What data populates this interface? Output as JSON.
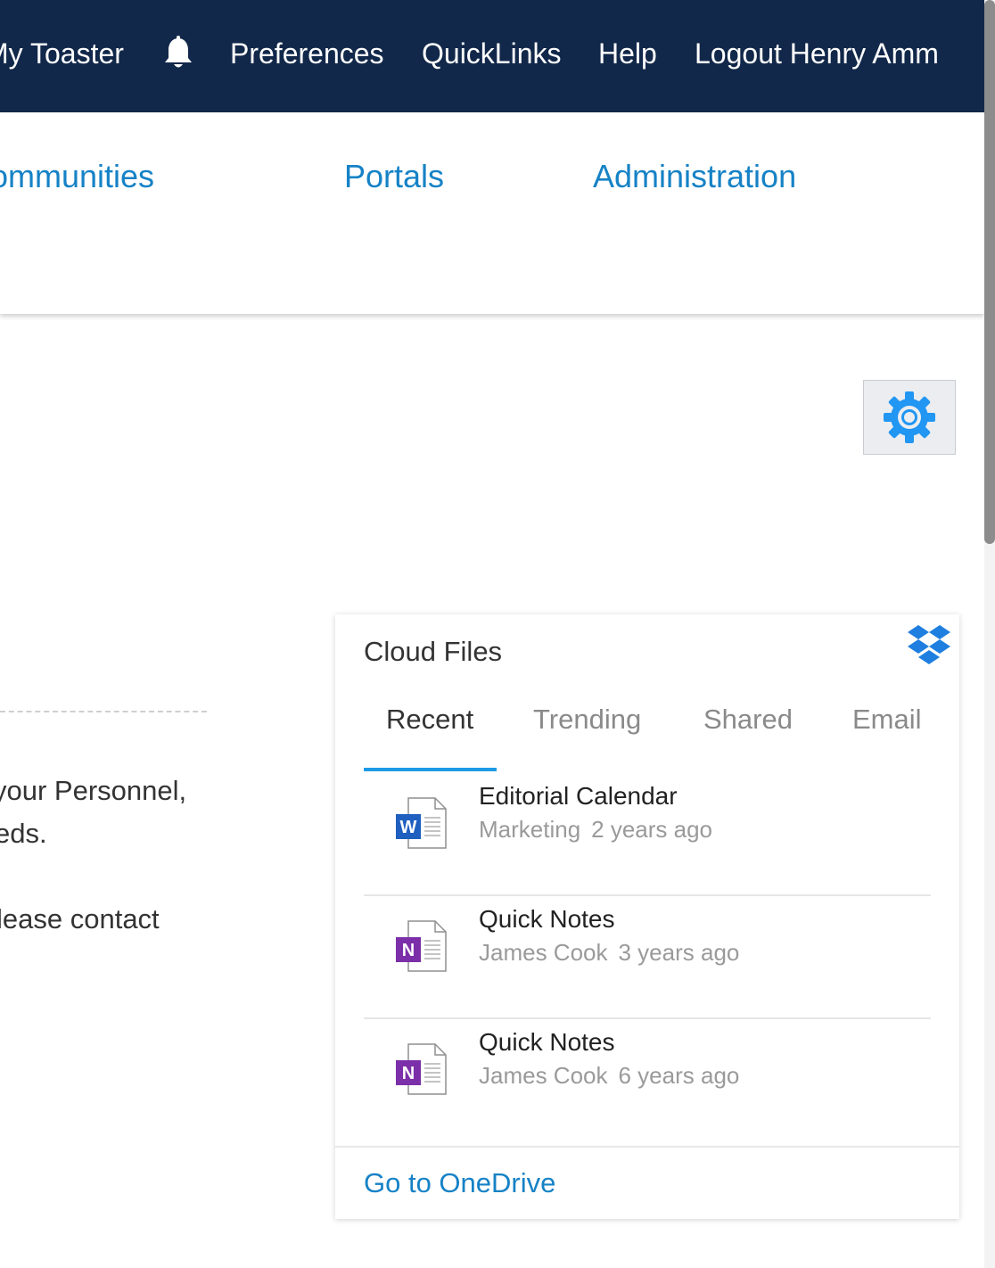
{
  "topbar": {
    "my_toaster": "My Toaster",
    "notifications_icon": "bell-icon",
    "preferences": "Preferences",
    "quicklinks": "QuickLinks",
    "help": "Help",
    "logout": "Logout Henry Amm"
  },
  "navbar": {
    "communities": "Communities",
    "portals": "Portals",
    "administration": "Administration"
  },
  "settings": {
    "icon": "gear-icon"
  },
  "background_text": {
    "line1": "your Personnel,",
    "line2": "eds.",
    "line3": "lease contact"
  },
  "cloud_files": {
    "title": "Cloud Files",
    "provider_icon": "dropbox-icon",
    "tabs": [
      {
        "label": "Recent",
        "active": true
      },
      {
        "label": "Trending",
        "active": false
      },
      {
        "label": "Shared",
        "active": false
      },
      {
        "label": "Email",
        "active": false
      }
    ],
    "files": [
      {
        "name": "Editorial Calendar",
        "owner": "Marketing",
        "age": "2 years ago",
        "type_icon": "word-doc-icon"
      },
      {
        "name": "Quick Notes",
        "owner": "James Cook",
        "age": "3 years ago",
        "type_icon": "onenote-doc-icon"
      },
      {
        "name": "Quick Notes",
        "owner": "James Cook",
        "age": "6 years ago",
        "type_icon": "onenote-doc-icon"
      }
    ],
    "footer_link": "Go to OneDrive"
  },
  "colors": {
    "topbar": "#12284a",
    "link": "#1682c6",
    "active_tab_underline": "#1e9ae6",
    "word": "#1f5fbf",
    "onenote": "#7b2fa8"
  }
}
